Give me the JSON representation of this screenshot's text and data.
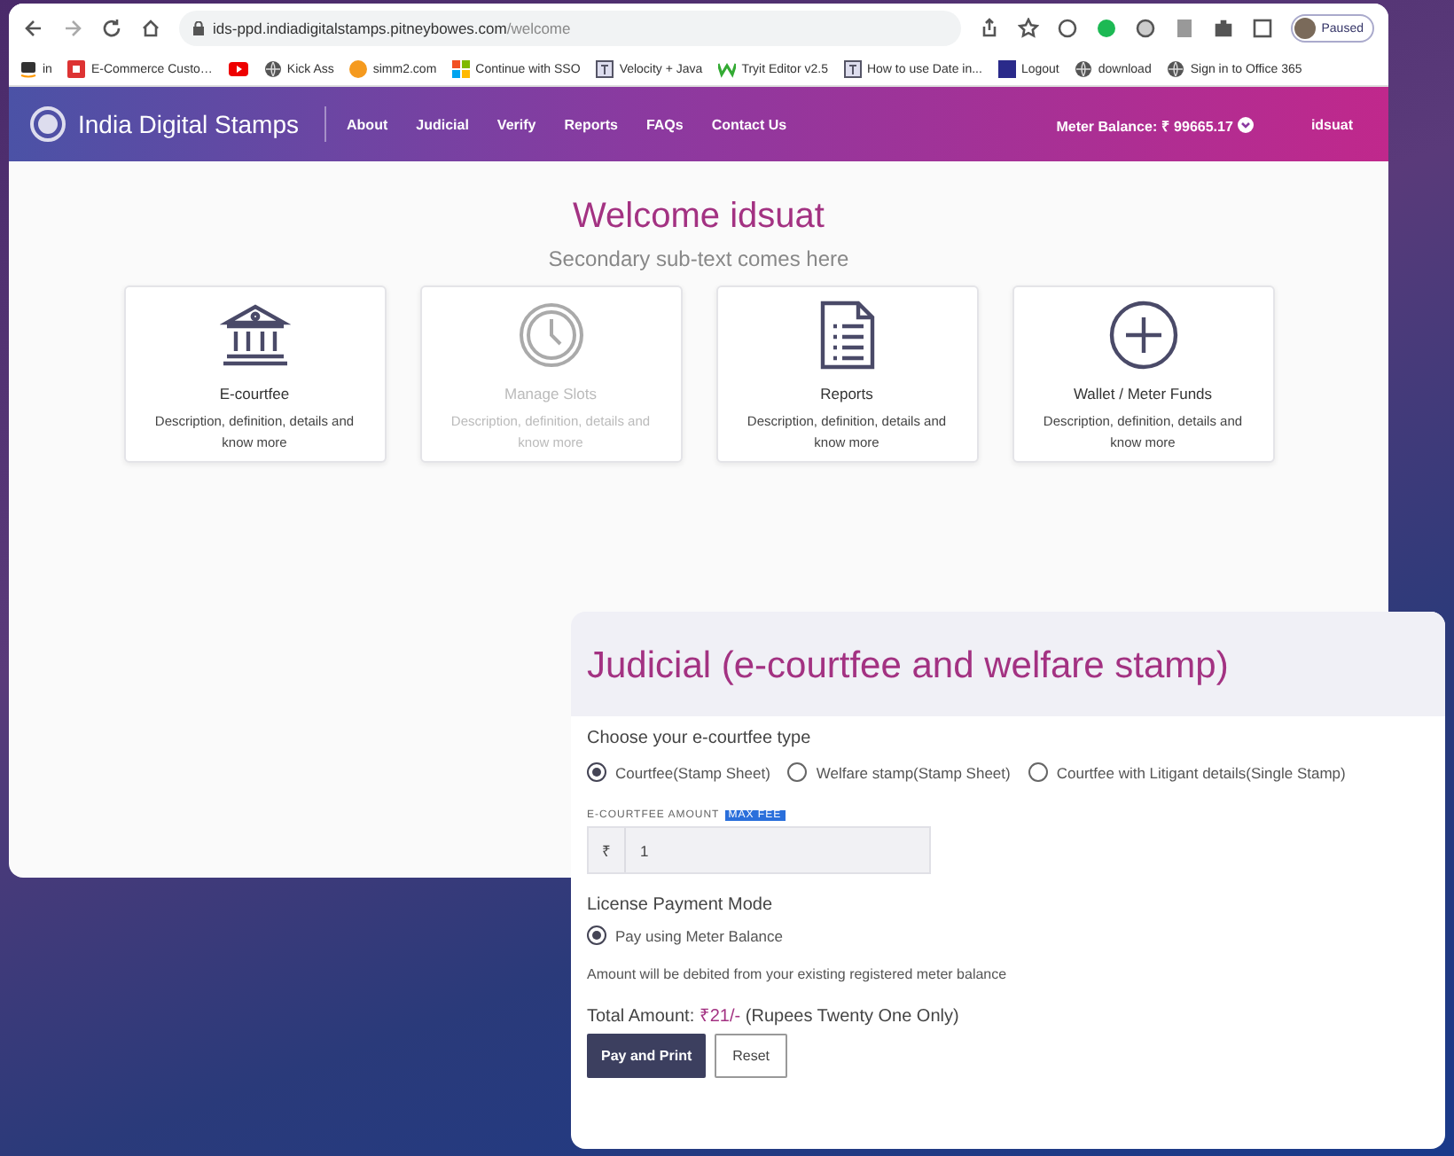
{
  "browser": {
    "url_host": "ids-ppd.indiadigitalstamps.pitneybowes.com",
    "url_path": "/welcome",
    "profile_status": "Paused",
    "bookmarks": [
      {
        "kind": "amazon",
        "label": "in"
      },
      {
        "kind": "app",
        "label": "E-Commerce Custo…"
      },
      {
        "kind": "video"
      },
      {
        "kind": "globe",
        "label": "Kick Ass"
      },
      {
        "kind": "orange",
        "label": "simm2.com"
      },
      {
        "kind": "grid",
        "label": "Continue with SSO"
      },
      {
        "kind": "doc",
        "label": "Velocity + Java"
      },
      {
        "kind": "w",
        "label": "Tryit Editor v2.5"
      },
      {
        "kind": "doc",
        "label": "How to use Date in..."
      },
      {
        "kind": "square",
        "label": "Logout"
      },
      {
        "kind": "globe",
        "label": "download"
      },
      {
        "kind": "globe",
        "label": "Sign in to Office 365"
      }
    ]
  },
  "site": {
    "brand": "India Digital Stamps",
    "nav": [
      {
        "label": "About"
      },
      {
        "label": "Judicial"
      },
      {
        "label": "Verify"
      },
      {
        "label": "Reports"
      },
      {
        "label": "FAQs"
      },
      {
        "label": "Contact Us"
      }
    ],
    "meter_balance": "Meter Balance: ₹ 99665.17",
    "user": "idsuat"
  },
  "home": {
    "title": "Welcome idsuat",
    "subtitle": "Secondary sub-text comes here",
    "cards": [
      {
        "kind": "bank",
        "title": "E-courtfee",
        "description": "Description, definition, details and know more",
        "disabled": false
      },
      {
        "kind": "clock",
        "title": "Manage Slots",
        "description": "Description, definition, details and know more",
        "disabled": true
      },
      {
        "kind": "document",
        "title": "Reports",
        "description": "Description, definition, details and know more",
        "disabled": false
      },
      {
        "kind": "plus",
        "title": "Wallet / Meter Funds",
        "description": "Description, definition, details and know more",
        "disabled": false
      }
    ]
  },
  "panel": {
    "title": "Judicial (e-courtfee and welfare stamp)",
    "question": "Choose your e-courtfee type",
    "fee_types": [
      {
        "label": "Courtfee(Stamp Sheet)",
        "selected": true
      },
      {
        "label": "Welfare stamp(Stamp Sheet)",
        "selected": false
      },
      {
        "label": "Courtfee with Litigant details(Single Stamp)",
        "selected": false
      }
    ],
    "amount_label": "E-COURTFEE AMOUNT",
    "amount_badge": "MAX FEE",
    "amount_prefix": "₹",
    "amount_value": "1",
    "payment_label": "License Payment Mode",
    "payment_modes": [
      {
        "label": "Pay using Meter Balance",
        "selected": true
      }
    ],
    "note": "Amount will be debited from your existing registered meter balance",
    "total_label": "Total Amount:",
    "total_value": "₹21/-",
    "total_words": "(Rupees Twenty One Only)",
    "buttons": [
      {
        "kind": "primary",
        "label": "Pay and Print"
      },
      {
        "kind": "secondary",
        "label": "Reset"
      }
    ]
  }
}
